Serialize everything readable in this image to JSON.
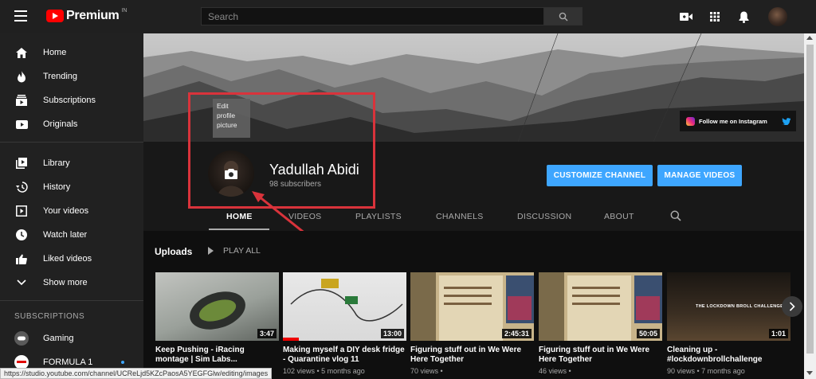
{
  "topbar": {
    "logo_text": "Premium",
    "logo_region": "IN",
    "search_placeholder": "Search",
    "icons": [
      "menu-icon",
      "youtube-logo-icon",
      "search-icon",
      "create-video-icon",
      "apps-grid-icon",
      "notifications-bell-icon",
      "account-avatar"
    ]
  },
  "sidebar": {
    "main": [
      {
        "label": "Home",
        "icon": "home-icon"
      },
      {
        "label": "Trending",
        "icon": "trending-flame-icon"
      },
      {
        "label": "Subscriptions",
        "icon": "subscriptions-icon"
      },
      {
        "label": "Originals",
        "icon": "originals-icon"
      }
    ],
    "library": [
      {
        "label": "Library",
        "icon": "library-icon"
      },
      {
        "label": "History",
        "icon": "history-icon"
      },
      {
        "label": "Your videos",
        "icon": "your-videos-icon"
      },
      {
        "label": "Watch later",
        "icon": "watch-later-clock-icon"
      },
      {
        "label": "Liked videos",
        "icon": "thumbs-up-icon"
      },
      {
        "label": "Show more",
        "icon": "chevron-down-icon"
      }
    ],
    "subscriptions_heading": "SUBSCRIPTIONS",
    "subscriptions": [
      {
        "label": "Gaming",
        "icon": "gaming-avatar"
      },
      {
        "label": "FORMULA 1",
        "icon": "formula1-avatar"
      }
    ]
  },
  "banner": {
    "instagram_label": "Follow me on Instagram",
    "icons": [
      "instagram-icon",
      "twitter-icon"
    ]
  },
  "channel": {
    "tooltip": "Edit profile picture",
    "name": "Yadullah Abidi",
    "subscribers": "98 subscribers",
    "customize_label": "CUSTOMIZE CHANNEL",
    "manage_label": "MANAGE VIDEOS"
  },
  "tabs": [
    "HOME",
    "VIDEOS",
    "PLAYLISTS",
    "CHANNELS",
    "DISCUSSION",
    "ABOUT"
  ],
  "uploads": {
    "title": "Uploads",
    "play_all": "PLAY ALL",
    "videos": [
      {
        "title": "Keep Pushing - iRacing montage | Sim Labs...",
        "duration": "3:47",
        "meta": ""
      },
      {
        "title": "Making myself a DIY desk fridge - Quarantine vlog 11",
        "duration": "13:00",
        "meta": "102 views • 5 months ago"
      },
      {
        "title": "Figuring stuff out in We Were Here Together",
        "duration": "2:45:31",
        "meta": "70 views •"
      },
      {
        "title": "Figuring stuff out in We Were Here Together",
        "duration": "50:05",
        "meta": "46 views •"
      },
      {
        "title": "Cleaning up - #lockdownbrollchallenge",
        "duration": "1:01",
        "meta": "90 views • 7 months ago"
      }
    ],
    "thumb5_text": "THE LOCKDOWN BROLL CHALLENGE"
  },
  "status_url": "https://studio.youtube.com/channel/UCReLjd5KZcPaosA5YEGFGlw/editing/images",
  "colors": {
    "accent_blue": "#3ea6ff",
    "youtube_red": "#ff0000",
    "highlight_red": "#d9333b",
    "background": "#181818",
    "sidebar": "#212121"
  }
}
